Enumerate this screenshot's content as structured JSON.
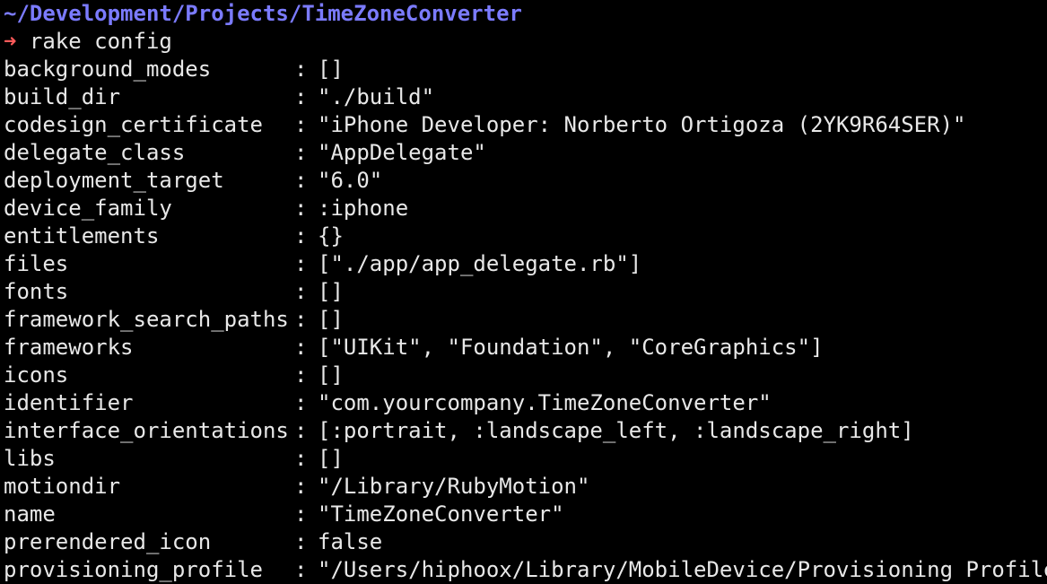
{
  "terminal": {
    "cwd": "~/Development/Projects/TimeZoneConverter",
    "prompt_symbol": "➜",
    "command": "rake config",
    "separator": ":",
    "colors": {
      "background": "#000000",
      "path": "#7b7bff",
      "prompt_arrow": "#ff5a5a",
      "text": "#e8e8e8"
    },
    "config_rows": [
      {
        "key": "background_modes",
        "value": "[]"
      },
      {
        "key": "build_dir",
        "value": "\"./build\""
      },
      {
        "key": "codesign_certificate",
        "value": "\"iPhone Developer: Norberto Ortigoza (2YK9R64SER)\""
      },
      {
        "key": "delegate_class",
        "value": "\"AppDelegate\""
      },
      {
        "key": "deployment_target",
        "value": "\"6.0\""
      },
      {
        "key": "device_family",
        "value": ":iphone"
      },
      {
        "key": "entitlements",
        "value": "{}"
      },
      {
        "key": "files",
        "value": "[\"./app/app_delegate.rb\"]"
      },
      {
        "key": "fonts",
        "value": "[]"
      },
      {
        "key": "framework_search_paths",
        "value": "[]"
      },
      {
        "key": "frameworks",
        "value": "[\"UIKit\", \"Foundation\", \"CoreGraphics\"]"
      },
      {
        "key": "icons",
        "value": "[]"
      },
      {
        "key": "identifier",
        "value": "\"com.yourcompany.TimeZoneConverter\""
      },
      {
        "key": "interface_orientations",
        "value": "[:portrait, :landscape_left, :landscape_right]"
      },
      {
        "key": "libs",
        "value": "[]"
      },
      {
        "key": "motiondir",
        "value": "\"/Library/RubyMotion\""
      },
      {
        "key": "name",
        "value": "\"TimeZoneConverter\""
      },
      {
        "key": "prerendered_icon",
        "value": "false"
      },
      {
        "key": "provisioning_profile",
        "value": "\"/Users/hiphoox/Library/MobileDevice/Provisioning Profiles"
      }
    ]
  }
}
